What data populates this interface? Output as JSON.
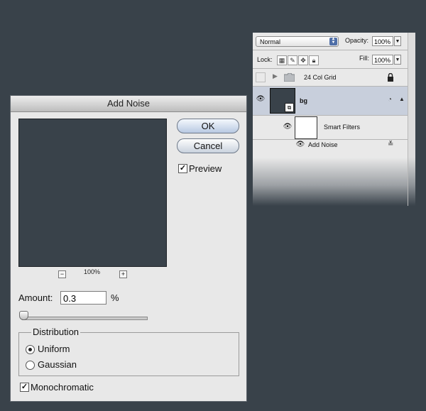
{
  "layers_panel": {
    "blend_mode": "Normal",
    "opacity_label": "Opacity:",
    "opacity_value": "100%",
    "lock_label": "Lock:",
    "fill_label": "Fill:",
    "fill_value": "100%",
    "layers": [
      {
        "name": "24 Col Grid",
        "type": "group",
        "visible": false
      },
      {
        "name": "bg",
        "type": "smart-object",
        "visible": true,
        "selected": true
      },
      {
        "name": "Smart Filters",
        "type": "smart-filters",
        "visible": true
      },
      {
        "name": "Add Noise",
        "type": "filter",
        "visible": true
      }
    ],
    "colors": {
      "panel": "#e9e9e9",
      "selected_row": "#c8cfdc"
    }
  },
  "dialog": {
    "title": "Add Noise",
    "ok_label": "OK",
    "cancel_label": "Cancel",
    "preview_label": "Preview",
    "preview_checked": true,
    "zoom_minus": "−",
    "zoom_plus": "+",
    "zoom_level": "100%",
    "amount_label": "Amount:",
    "amount_value": "0.3",
    "amount_unit": "%",
    "amount_slider_fraction": 0.003,
    "distribution_title": "Distribution",
    "distribution_options": [
      "Uniform",
      "Gaussian"
    ],
    "distribution_selected": "Uniform",
    "monochromatic_label": "Monochromatic",
    "monochromatic_checked": true
  },
  "colors": {
    "background": "#39424a",
    "dialog": "#e8e8e8",
    "preview_fill": "#39424a"
  }
}
